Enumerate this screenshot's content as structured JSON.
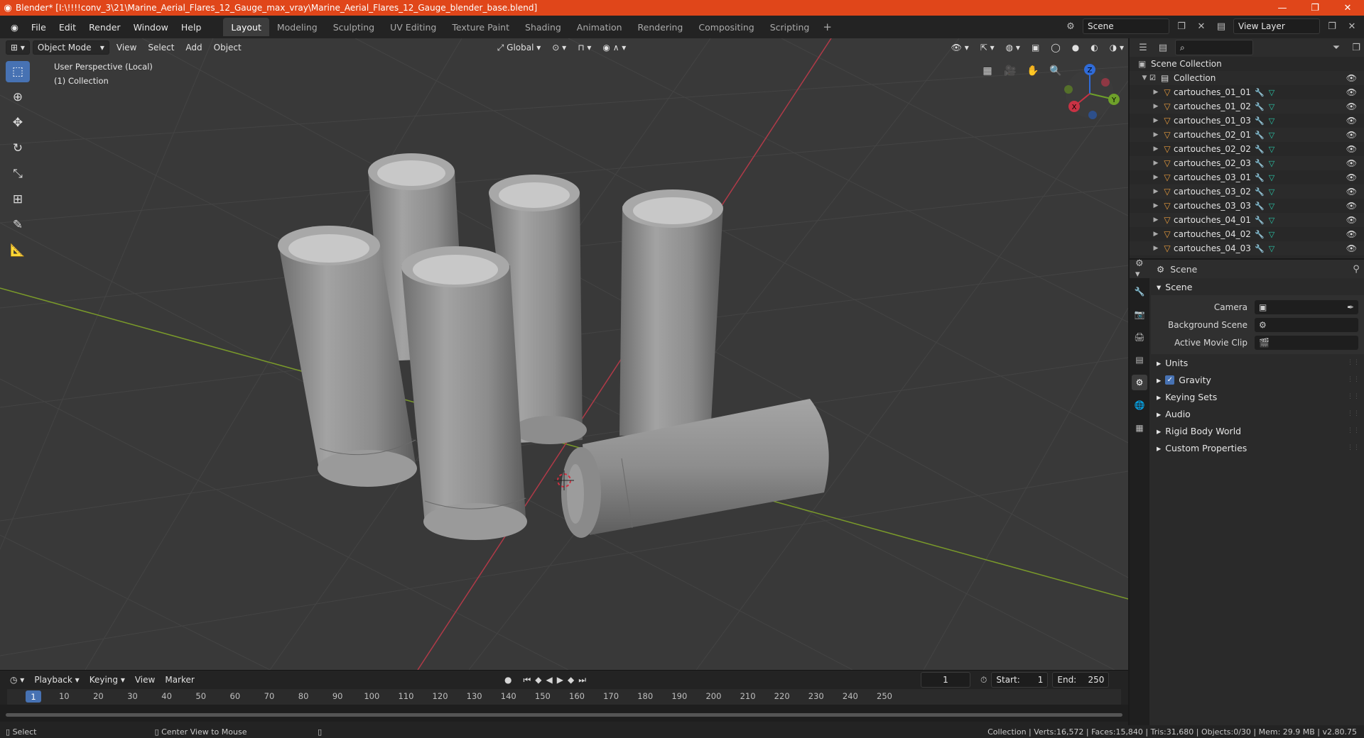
{
  "window": {
    "title": "Blender* [I:\\!!!!conv_3\\21\\Marine_Aerial_Flares_12_Gauge_max_vray\\Marine_Aerial_Flares_12_Gauge_blender_base.blend]",
    "minimize": "—",
    "maximize": "❐",
    "close": "✕"
  },
  "menu": [
    "File",
    "Edit",
    "Render",
    "Window",
    "Help"
  ],
  "workspaces": [
    "Layout",
    "Modeling",
    "Sculpting",
    "UV Editing",
    "Texture Paint",
    "Shading",
    "Animation",
    "Rendering",
    "Compositing",
    "Scripting"
  ],
  "active_workspace": "Layout",
  "scene_field": "Scene",
  "view_layer_field": "View Layer",
  "viewport": {
    "mode": "Object Mode",
    "menus": [
      "View",
      "Select",
      "Add",
      "Object"
    ],
    "transform_orientation": "Global",
    "info_line1": "User Perspective (Local)",
    "info_line2": "(1) Collection",
    "gizmo_labels": {
      "x": "X",
      "y": "Y",
      "z": "Z"
    }
  },
  "outliner": {
    "scene_collection": "Scene Collection",
    "collection": "Collection",
    "objects": [
      "cartouches_01_01",
      "cartouches_01_02",
      "cartouches_01_03",
      "cartouches_02_01",
      "cartouches_02_02",
      "cartouches_02_03",
      "cartouches_03_01",
      "cartouches_03_02",
      "cartouches_03_03",
      "cartouches_04_01",
      "cartouches_04_02",
      "cartouches_04_03"
    ]
  },
  "properties": {
    "header_title": "Scene",
    "panel_title": "Scene",
    "rows": [
      {
        "label": "Camera",
        "value": ""
      },
      {
        "label": "Background Scene",
        "value": ""
      },
      {
        "label": "Active Movie Clip",
        "value": ""
      }
    ],
    "subpanels": [
      "Units",
      "Gravity",
      "Keying Sets",
      "Audio",
      "Rigid Body World",
      "Custom Properties"
    ],
    "gravity_checked": true
  },
  "timeline": {
    "menus": [
      "Playback",
      "Keying",
      "View",
      "Marker"
    ],
    "current_frame": "1",
    "start_label": "Start:",
    "start": "1",
    "end_label": "End:",
    "end": "250",
    "ticks": [
      1,
      10,
      20,
      30,
      40,
      50,
      60,
      70,
      80,
      90,
      100,
      110,
      120,
      130,
      140,
      150,
      160,
      170,
      180,
      190,
      200,
      210,
      220,
      230,
      240,
      250
    ]
  },
  "statusbar": {
    "left_action": "Select",
    "middle_action": "Center View to Mouse",
    "stats": "Collection | Verts:16,572 | Faces:15,840 | Tris:31,680 | Objects:0/30 | Mem: 29.9 MB | v2.80.75"
  },
  "colors": {
    "titlebar": "#e0461a",
    "accent_blue": "#4772b3",
    "object_orange": "#e59a3d",
    "mesh_teal": "#29c6a8"
  }
}
